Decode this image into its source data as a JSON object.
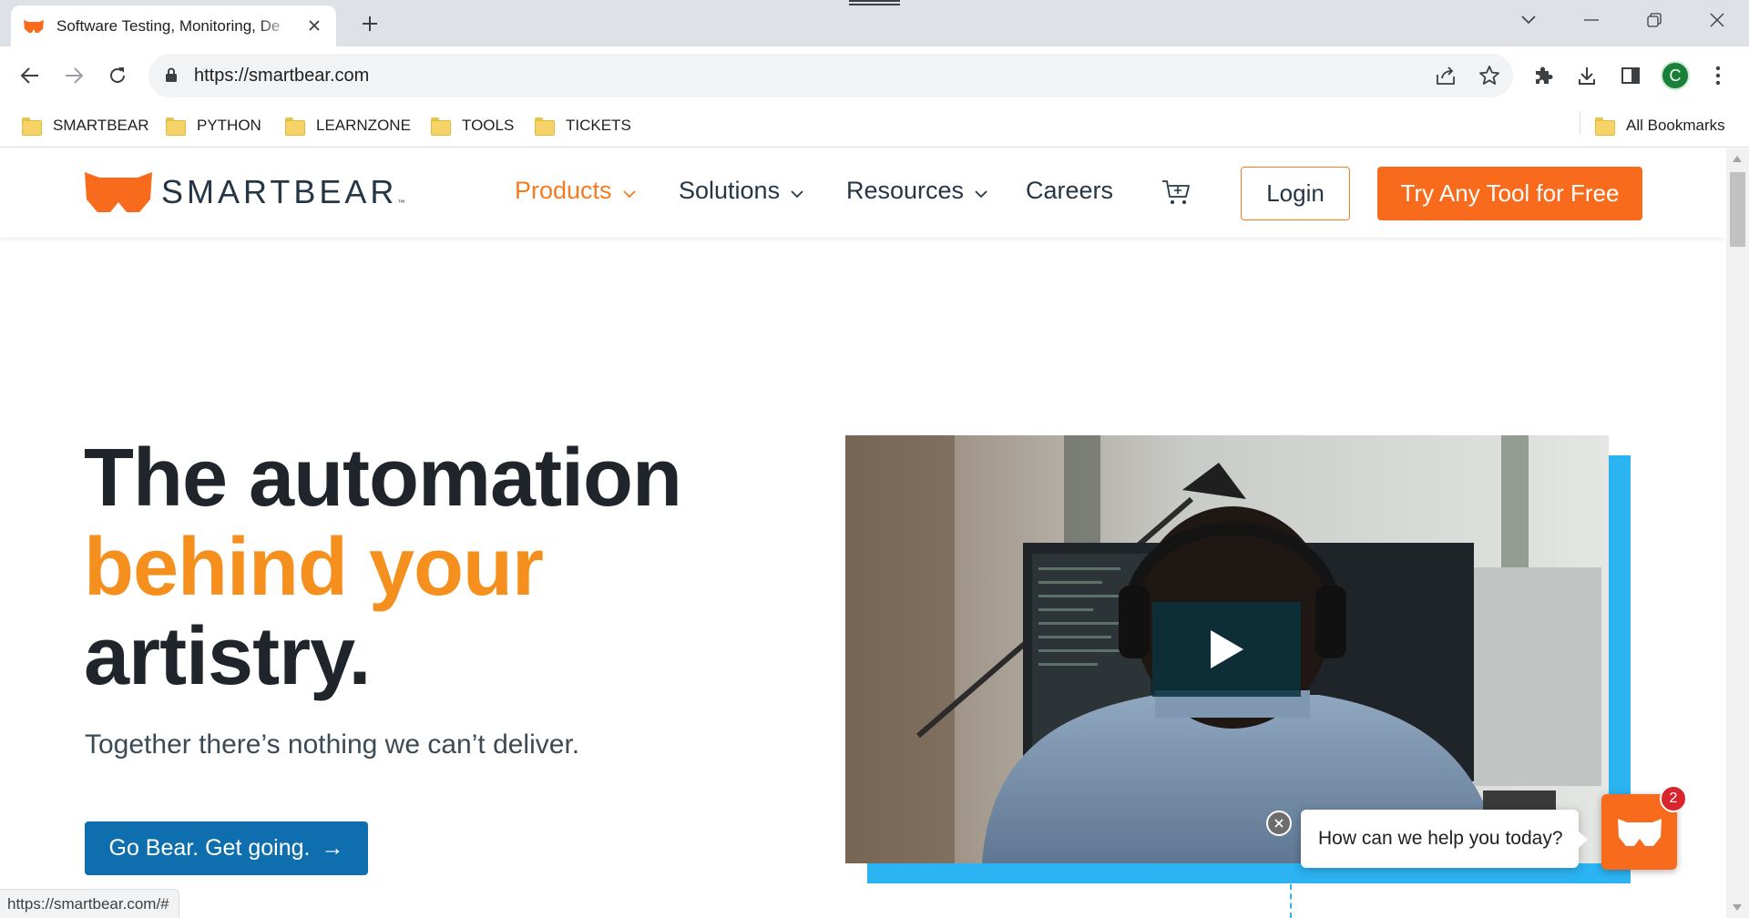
{
  "browser": {
    "tab": {
      "title": "Software Testing, Monitoring, De",
      "favicon": "smartbear-favicon"
    },
    "address": {
      "url": "https://smartbear.com"
    },
    "bookmarks": [
      {
        "label": "SMARTBEAR"
      },
      {
        "label": "PYTHON"
      },
      {
        "label": "LEARNZONE"
      },
      {
        "label": "TOOLS"
      },
      {
        "label": "TICKETS"
      }
    ],
    "all_bookmarks": "All Bookmarks",
    "profile_initial": "C",
    "status_url": "https://smartbear.com/#"
  },
  "site": {
    "logo": {
      "text": "SMARTBEAR",
      "tm": "™"
    },
    "nav": {
      "products": "Products",
      "solutions": "Solutions",
      "resources": "Resources",
      "careers": "Careers"
    },
    "login": "Login",
    "try_free": "Try Any Tool for Free"
  },
  "hero": {
    "title_line1": "The automation",
    "title_line2": "behind your",
    "title_line3": "artistry.",
    "subtitle": "Together there’s nothing we can’t deliver.",
    "cta": "Go Bear. Get going.",
    "cta_arrow": "→"
  },
  "chat": {
    "prompt": "How can we help you today?",
    "badge_count": "2"
  },
  "colors": {
    "brand_orange": "#f86b1c",
    "accent_orange": "#f5901e",
    "cta_blue": "#0f6fae",
    "frame_blue": "#2bb3f2",
    "navy": "#253746"
  }
}
